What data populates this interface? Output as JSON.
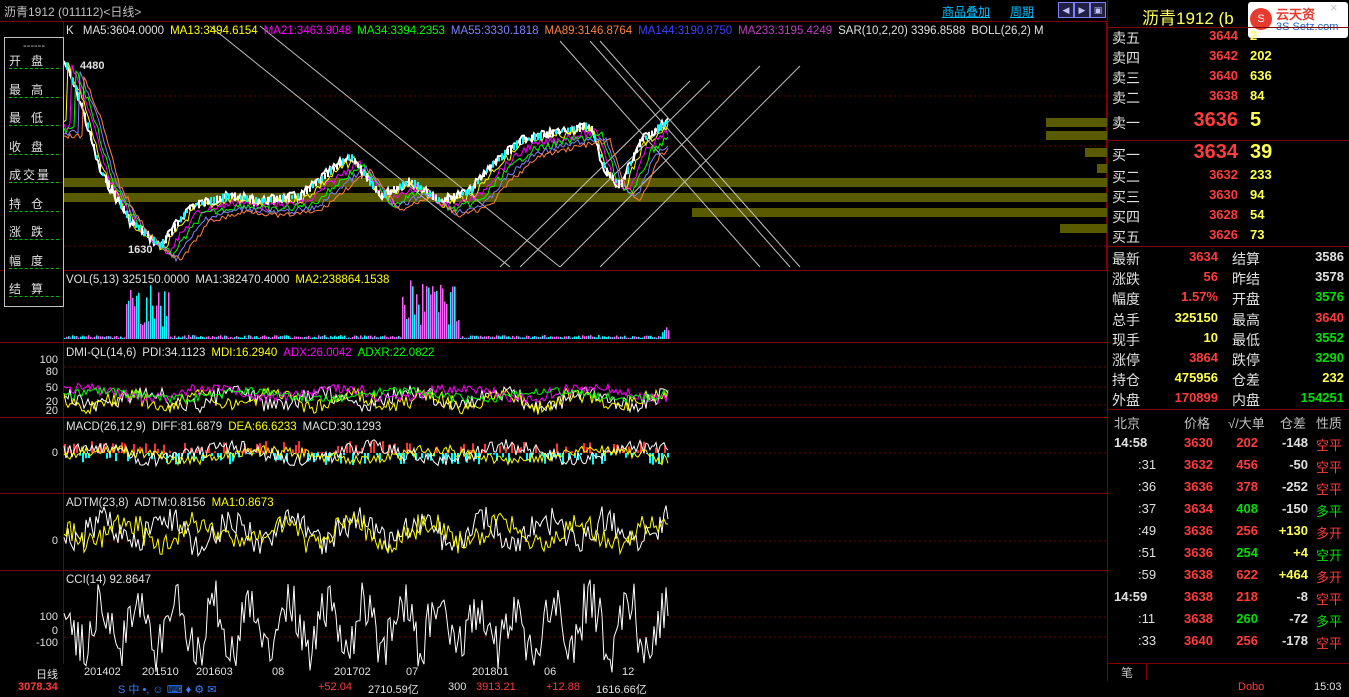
{
  "window": {
    "title": "沥青1912 (011112)<日线>",
    "links": [
      "商品叠加",
      "周期"
    ],
    "right_title": "沥青1912 (b",
    "logo_text": "3S Setz.com",
    "logo_cn": "云天资",
    "close_glyph": "×"
  },
  "info_box": {
    "dash": "------",
    "labels": [
      "开盘",
      "最高",
      "最低",
      "收盘",
      "成交量",
      "持仓",
      "涨跌",
      "幅度",
      "结算"
    ]
  },
  "main_chart": {
    "k_label": "K",
    "ma_legend": [
      {
        "text": "MA5:3604.0000",
        "color": "#e0e0e0"
      },
      {
        "text": "MA13:3494.6154",
        "color": "#ffff00"
      },
      {
        "text": "MA21:3463.9048",
        "color": "#ff00ff"
      },
      {
        "text": "MA34:3394.2353",
        "color": "#00ff00"
      },
      {
        "text": "MA55:3330.1818",
        "color": "#8080ff"
      },
      {
        "text": "MA89:3146.8764",
        "color": "#ff8040"
      },
      {
        "text": "MA144:3190.8750",
        "color": "#4040ff"
      },
      {
        "text": "MA233:3195.4249",
        "color": "#c040c0"
      },
      {
        "text": "SAR(10,2,20)  3396.8588",
        "color": "#e0e0e0"
      },
      {
        "text": "BOLL(26,2) M",
        "color": "#e0e0e0"
      }
    ],
    "high_label": "4480",
    "low_label": "1630"
  },
  "vol_panel": {
    "legend": [
      {
        "text": "VOL(5,13) 325150.0000",
        "color": "#e0e0e0"
      },
      {
        "text": "MA1:382470.4000",
        "color": "#e0e0e0"
      },
      {
        "text": "MA2:238864.1538",
        "color": "#ffff00"
      }
    ]
  },
  "dmi_panel": {
    "legend": [
      {
        "text": "DMI-QL(14,6)",
        "color": "#e0e0e0"
      },
      {
        "text": "PDI:34.1123",
        "color": "#e0e0e0"
      },
      {
        "text": "MDI:16.2940",
        "color": "#ffff00"
      },
      {
        "text": "ADX:26.0042",
        "color": "#ff00ff"
      },
      {
        "text": "ADXR:22.0822",
        "color": "#00ff00"
      }
    ],
    "yticks": [
      "100",
      "80",
      "50",
      "20",
      "20"
    ]
  },
  "macd_panel": {
    "legend": [
      {
        "text": "MACD(26,12,9)",
        "color": "#e0e0e0"
      },
      {
        "text": "DIFF:81.6879",
        "color": "#e0e0e0"
      },
      {
        "text": "DEA:66.6233",
        "color": "#ffff00"
      },
      {
        "text": "MACD:30.1293",
        "color": "#e0e0e0"
      }
    ],
    "ytick": "0"
  },
  "adtm_panel": {
    "legend": [
      {
        "text": "ADTM(23,8)",
        "color": "#e0e0e0"
      },
      {
        "text": "ADTM:0.8156",
        "color": "#e0e0e0"
      },
      {
        "text": "MA1:0.8673",
        "color": "#ffff00"
      }
    ],
    "ytick": "0"
  },
  "cci_panel": {
    "legend": [
      {
        "text": "CCI(14) 92.8647",
        "color": "#e0e0e0"
      }
    ],
    "yticks": [
      "100",
      "0",
      "-100"
    ]
  },
  "x_axis": {
    "period_label": "日线",
    "labels": [
      "201402",
      "201510",
      "201603",
      "08",
      "201702",
      "07",
      "201801",
      "06",
      "12"
    ]
  },
  "order_book": {
    "asks": [
      {
        "label": "卖五",
        "price": "3644",
        "vol": "2"
      },
      {
        "label": "卖四",
        "price": "3642",
        "vol": "202"
      },
      {
        "label": "卖三",
        "price": "3640",
        "vol": "636"
      },
      {
        "label": "卖二",
        "price": "3638",
        "vol": "84"
      },
      {
        "label": "卖一",
        "price": "3636",
        "vol": "5"
      }
    ],
    "bids": [
      {
        "label": "买一",
        "price": "3634",
        "vol": "39"
      },
      {
        "label": "买二",
        "price": "3632",
        "vol": "233"
      },
      {
        "label": "买三",
        "price": "3630",
        "vol": "94"
      },
      {
        "label": "买四",
        "price": "3628",
        "vol": "54"
      },
      {
        "label": "买五",
        "price": "3626",
        "vol": "73"
      }
    ]
  },
  "quote": [
    {
      "l1": "最新",
      "v1": "3634",
      "c1": "red",
      "l2": "结算",
      "v2": "3586",
      "c2": "wht"
    },
    {
      "l1": "涨跌",
      "v1": "56",
      "c1": "red",
      "l2": "昨结",
      "v2": "3578",
      "c2": "wht"
    },
    {
      "l1": "幅度",
      "v1": "1.57%",
      "c1": "red",
      "l2": "开盘",
      "v2": "3576",
      "c2": "grn"
    },
    {
      "l1": "总手",
      "v1": "325150",
      "c1": "yel",
      "l2": "最高",
      "v2": "3640",
      "c2": "red"
    },
    {
      "l1": "现手",
      "v1": "10",
      "c1": "yel",
      "l2": "最低",
      "v2": "3552",
      "c2": "grn"
    },
    {
      "l1": "涨停",
      "v1": "3864",
      "c1": "red",
      "l2": "跌停",
      "v2": "3290",
      "c2": "grn"
    },
    {
      "l1": "持仓",
      "v1": "475956",
      "c1": "yel",
      "l2": "仓差",
      "v2": "232",
      "c2": "yel"
    },
    {
      "l1": "外盘",
      "v1": "170899",
      "c1": "red",
      "l2": "内盘",
      "v2": "154251",
      "c2": "grn"
    }
  ],
  "ticks_header": {
    "loc": "北京",
    "price": "价格",
    "big": "√/大单",
    "diff": "仓差",
    "nature": "性质"
  },
  "ticks": [
    {
      "time": "14:58",
      "price": "3630",
      "pc": "red",
      "vol": "202",
      "vc": "red",
      "diff": "-148",
      "nature": "空平",
      "nc": "red"
    },
    {
      "time": ":31",
      "price": "3632",
      "pc": "red",
      "vol": "456",
      "vc": "red",
      "diff": "-50",
      "nature": "空平",
      "nc": "red"
    },
    {
      "time": ":36",
      "price": "3636",
      "pc": "red",
      "vol": "378",
      "vc": "red",
      "diff": "-252",
      "nature": "空平",
      "nc": "red"
    },
    {
      "time": ":37",
      "price": "3634",
      "pc": "red",
      "vol": "408",
      "vc": "grn",
      "diff": "-150",
      "nature": "多平",
      "nc": "grn"
    },
    {
      "time": ":49",
      "price": "3636",
      "pc": "red",
      "vol": "256",
      "vc": "red",
      "diff": "+130",
      "nature": "多开",
      "nc": "red"
    },
    {
      "time": ":51",
      "price": "3636",
      "pc": "red",
      "vol": "254",
      "vc": "grn",
      "diff": "+4",
      "nature": "空开",
      "nc": "grn"
    },
    {
      "time": ":59",
      "price": "3638",
      "pc": "red",
      "vol": "622",
      "vc": "red",
      "diff": "+464",
      "nature": "多开",
      "nc": "red"
    },
    {
      "time": "14:59",
      "price": "3638",
      "pc": "red",
      "vol": "218",
      "vc": "red",
      "diff": "-8",
      "nature": "空平",
      "nc": "red"
    },
    {
      "time": ":11",
      "price": "3638",
      "pc": "red",
      "vol": "260",
      "vc": "grn",
      "diff": "-72",
      "nature": "多平",
      "nc": "grn"
    },
    {
      "time": ":33",
      "price": "3640",
      "pc": "red",
      "vol": "256",
      "vc": "red",
      "diff": "-178",
      "nature": "空平",
      "nc": "red"
    }
  ],
  "bottom_tab": "笔",
  "taskbar": {
    "left_value": "3078.34",
    "mid1": "+52.04",
    "mid2": "2710.59亿",
    "mid3": "300",
    "mid4": "3913.21",
    "mid5": "+12.88",
    "mid6": "1616.66亿",
    "right1": "Dobo",
    "right2": "15:03"
  }
}
